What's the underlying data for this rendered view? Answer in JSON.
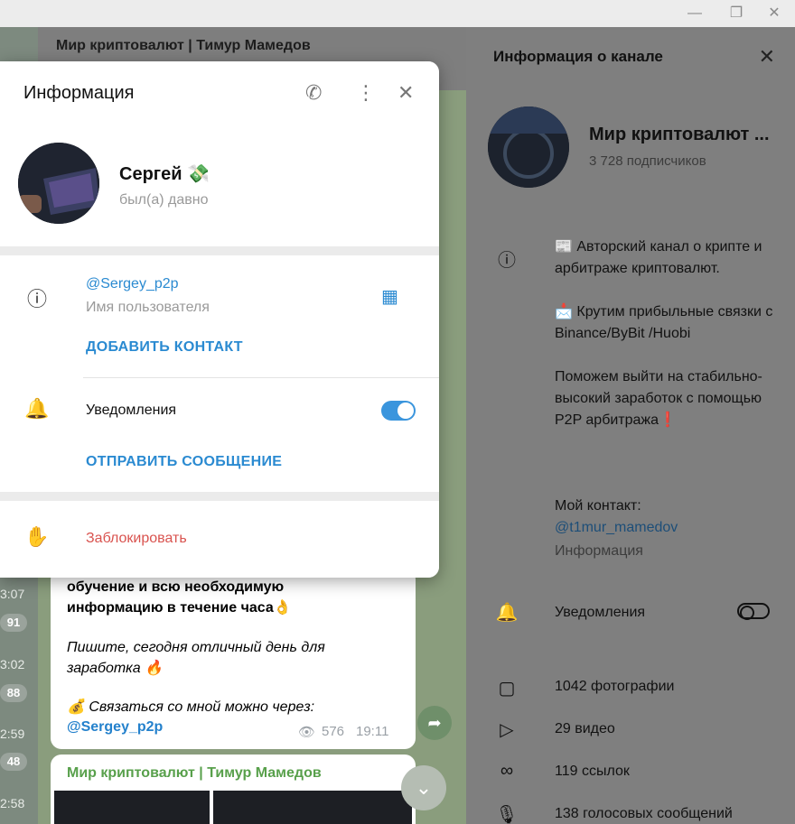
{
  "window": {
    "minimize_glyph": "—",
    "restore_glyph": "❐",
    "close_glyph": "✕"
  },
  "left_strip": {
    "times": [
      "3:07",
      "3:02",
      "2:59",
      "2:58"
    ],
    "counts": [
      "91",
      "88",
      "48"
    ]
  },
  "chat": {
    "title": "Мир криптовалют | Тимур Мамедов",
    "message": {
      "line1": "обучение и всю необходимую",
      "line2": "информацию в течение часа👌",
      "line3": "Пишите, сегодня отличный день для",
      "line4": "заработка 🔥",
      "line5": "💰 Связаться со мной можно через:",
      "link": "@Sergey_p2p",
      "views": "576",
      "time": "19:11"
    },
    "next_message": {
      "channel": "Мир криптовалют | Тимур Мамедов"
    }
  },
  "channel_info": {
    "header": "Информация о канале",
    "name": "Мир криптовалют ...",
    "subscribers": "3 728 подписчиков",
    "desc1": "📰 Авторский канал о крипте и арбитраже криптовалют.",
    "desc2": "📩 Крутим прибыльные связки с Binance/ByBit /Huobi",
    "desc3": "Поможем выйти на стабильно-высокий заработок с помощью P2P арбитража❗",
    "contact_label": "Мой контакт:",
    "contact_link": "@t1mur_mamedov",
    "info_label": "Информация",
    "notifications": "Уведомления",
    "media": [
      {
        "icon": "photo-icon",
        "label": "1042 фотографии"
      },
      {
        "icon": "video-icon",
        "label": "29 видео"
      },
      {
        "icon": "link-icon",
        "label": "119 ссылок"
      },
      {
        "icon": "mic-icon",
        "label": "138 голосовых сообщений"
      }
    ]
  },
  "user_popup": {
    "title": "Информация",
    "name": "Сергей 💸",
    "status": "был(а) давно",
    "username": "@Sergey_p2p",
    "username_label": "Имя пользователя",
    "add_contact": "ДОБАВИТЬ КОНТАКТ",
    "notifications": "Уведомления",
    "notifications_on": true,
    "send_message": "ОТПРАВИТЬ СООБЩЕНИЕ",
    "block": "Заблокировать"
  },
  "colors": {
    "accent": "#2a8ad1",
    "danger": "#d9534f",
    "toggle_on": "#3a95dd"
  }
}
